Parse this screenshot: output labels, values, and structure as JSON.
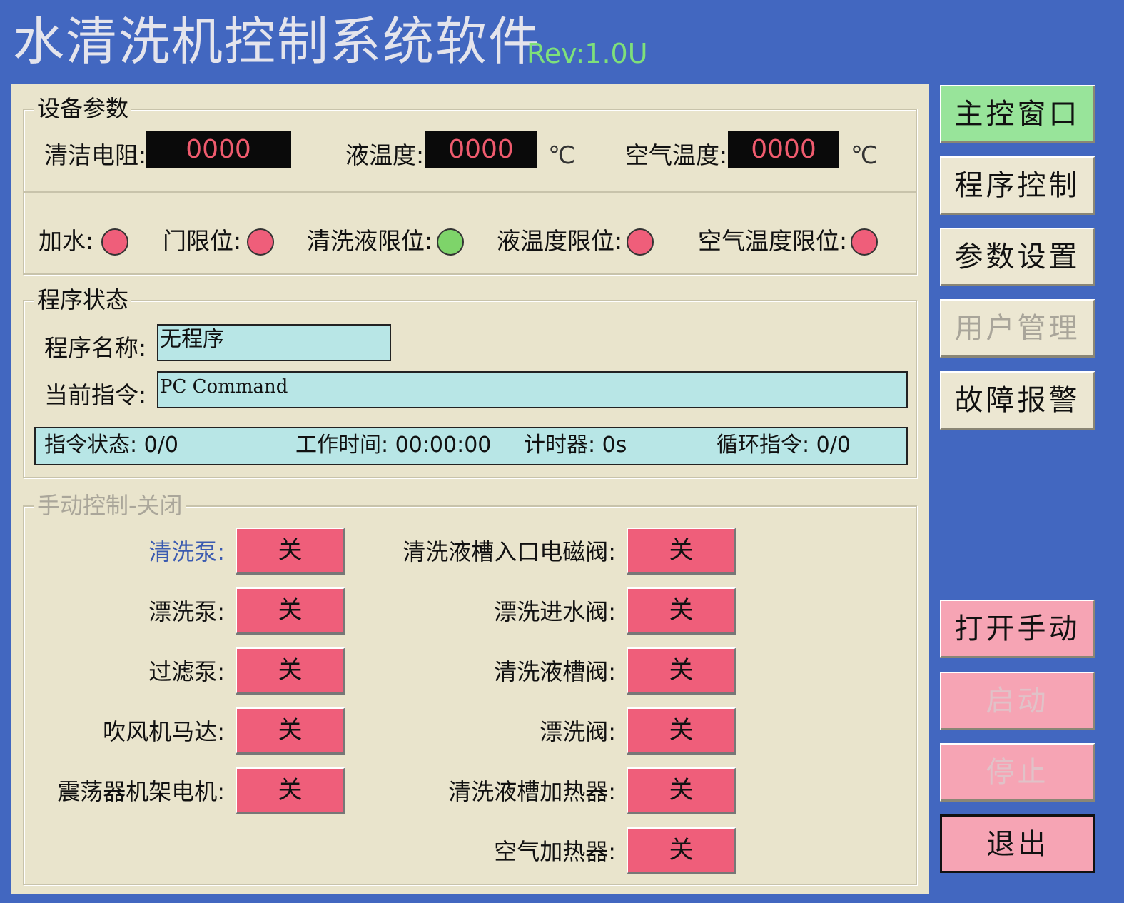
{
  "header": {
    "title": "水清洗机控制系统软件",
    "rev": "Rev:1.0U"
  },
  "colors": {
    "background": "#4267c0",
    "panel": "#e9e4cc",
    "led_off": "#ef5e7a",
    "led_on": "#7ed46a",
    "button_off": "#ef5e7a",
    "nav_active": "#98e49a",
    "nav_pink": "#f6a4b4",
    "field": "#b8e6e6"
  },
  "device_params": {
    "legend": "设备参数",
    "readouts": [
      {
        "label": "清洁电阻:",
        "value": "0000",
        "unit": ""
      },
      {
        "label": "液温度:",
        "value": "0000",
        "unit": "℃"
      },
      {
        "label": "空气温度:",
        "value": "0000",
        "unit": "℃"
      }
    ],
    "indicators": [
      {
        "label": "加水:",
        "state": "off"
      },
      {
        "label": "门限位:",
        "state": "off"
      },
      {
        "label": "清洗液限位:",
        "state": "on"
      },
      {
        "label": "液温度限位:",
        "state": "off"
      },
      {
        "label": "空气温度限位:",
        "state": "off"
      }
    ]
  },
  "program_status": {
    "legend": "程序状态",
    "name_label": "程序名称:",
    "name_value": "无程序",
    "command_label": "当前指令:",
    "command_value": "PC Command",
    "status_bar": [
      "指令状态: 0/0",
      "工作时间: 00:00:00",
      "计时器: 0s",
      "循环指令: 0/0"
    ]
  },
  "manual_control": {
    "legend": "手动控制-关闭",
    "left": [
      {
        "label": "清洗泵:",
        "button": "关"
      },
      {
        "label": "漂洗泵:",
        "button": "关"
      },
      {
        "label": "过滤泵:",
        "button": "关"
      },
      {
        "label": "吹风机马达:",
        "button": "关"
      },
      {
        "label": "震荡器机架电机:",
        "button": "关"
      }
    ],
    "right": [
      {
        "label": "清洗液槽入口电磁阀:",
        "button": "关"
      },
      {
        "label": "漂洗进水阀:",
        "button": "关"
      },
      {
        "label": "清洗液槽阀:",
        "button": "关"
      },
      {
        "label": "漂洗阀:",
        "button": "关"
      },
      {
        "label": "清洗液槽加热器:",
        "button": "关"
      },
      {
        "label": "空气加热器:",
        "button": "关"
      }
    ]
  },
  "nav": {
    "main_window": "主控窗口",
    "program_control": "程序控制",
    "param_settings": "参数设置",
    "user_management": "用户管理",
    "fault_alarm": "故障报警",
    "open_manual": "打开手动",
    "start": "启动",
    "stop": "停止",
    "exit": "退出"
  }
}
